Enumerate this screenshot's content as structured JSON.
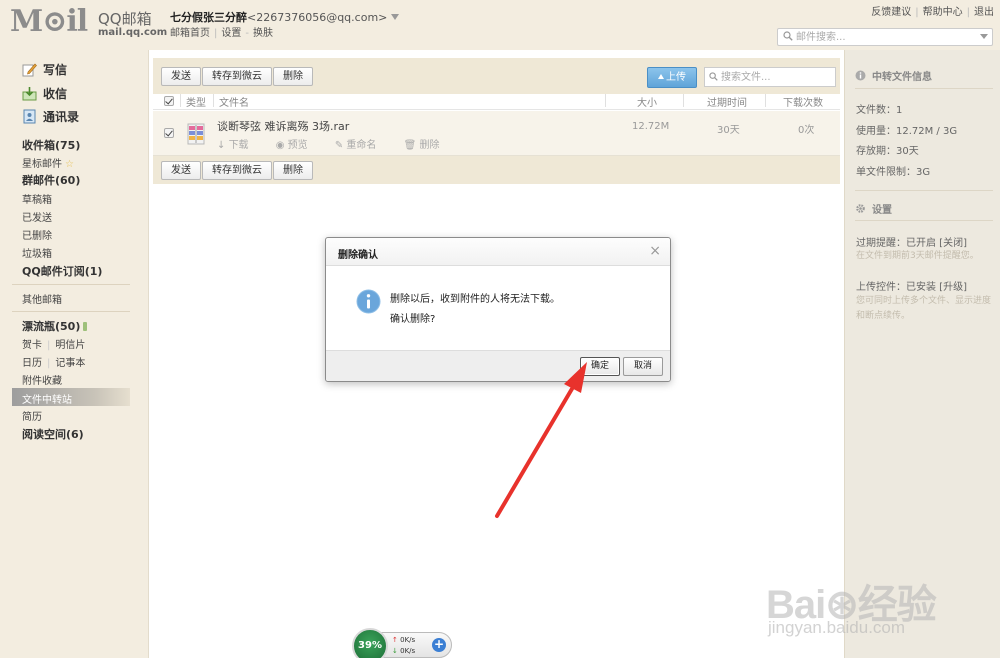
{
  "header": {
    "logo_text": "M⊙il",
    "logo_cn": "QQ邮箱",
    "logo_url": "mail.qq.com",
    "user_name": "七分假张三分醉",
    "user_email": "<2267376056@qq.com>",
    "links": [
      "邮箱首页",
      "设置",
      "换肤"
    ],
    "top_links": [
      "反馈建议",
      "帮助中心",
      "退出"
    ],
    "search_placeholder": "邮件搜索..."
  },
  "sidebar": {
    "compose": "写信",
    "inbox_btn": "收信",
    "contacts": "通讯录",
    "folders": [
      {
        "label": "收件箱(75)",
        "bold": true
      },
      {
        "label": "星标邮件",
        "bold": false,
        "star": "☆"
      },
      {
        "label": "群邮件(60)",
        "bold": true
      },
      {
        "label": "草稿箱",
        "bold": false
      },
      {
        "label": "已发送",
        "bold": false
      },
      {
        "label": "已删除",
        "bold": false
      },
      {
        "label": "垃圾箱",
        "bold": false
      },
      {
        "label": "QQ邮件订阅(1)",
        "bold": true
      }
    ],
    "other_mailbox": "其他邮箱",
    "drift_bottle": "漂流瓶(50)",
    "card": "贺卡",
    "postcard": "明信片",
    "calendar": "日历",
    "notepad": "记事本",
    "attachments": "附件收藏",
    "file_transfer": "文件中转站",
    "resume": "简历",
    "reading": "阅读空间(6)"
  },
  "toolbar": {
    "send": "发送",
    "save_to_cloud": "转存到微云",
    "delete": "删除",
    "upload": "上传",
    "file_search_placeholder": "搜索文件..."
  },
  "table": {
    "headers": {
      "type": "类型",
      "name": "文件名",
      "size": "大小",
      "expire": "过期时间",
      "downloads": "下载次数"
    },
    "rows": [
      {
        "name": "谈断琴弦 难诉离殇 3场.rar",
        "size": "12.72M",
        "expire": "30天",
        "downloads": "0次",
        "actions": [
          "下载",
          "预览",
          "重命名",
          "删除"
        ]
      }
    ]
  },
  "right_panel": {
    "info_title": "中转文件信息",
    "file_count": "文件数：1",
    "usage": "使用量：12.72M / 3G",
    "retention": "存放期：30天",
    "size_limit": "单文件限制：3G",
    "settings_title": "设置",
    "expire_reminder": "过期提醒：已开启 [关闭]",
    "expire_hint": "在文件到期前3天邮件提醒您。",
    "upload_plugin": "上传控件：已安装 [升级]",
    "upload_hint": "您可同时上传多个文件、显示进度和断点续传。"
  },
  "dialog": {
    "title": "删除确认",
    "close": "×",
    "message_line1": "删除以后，收到附件的人将无法下载。",
    "message_line2": "确认删除?",
    "ok": "确定",
    "cancel": "取消"
  },
  "speed_widget": {
    "percent": "39%",
    "up": "0K/s",
    "down": "0K/s",
    "plus": "+"
  },
  "watermark": {
    "main": "Bai⊛经验",
    "url": "jingyan.baidu.com"
  },
  "colors": {
    "accent_blue": "#5fa4d9",
    "arrow_red": "#e8322c",
    "info_blue": "#7ab3e0",
    "page_bg": "#f3ede0"
  }
}
